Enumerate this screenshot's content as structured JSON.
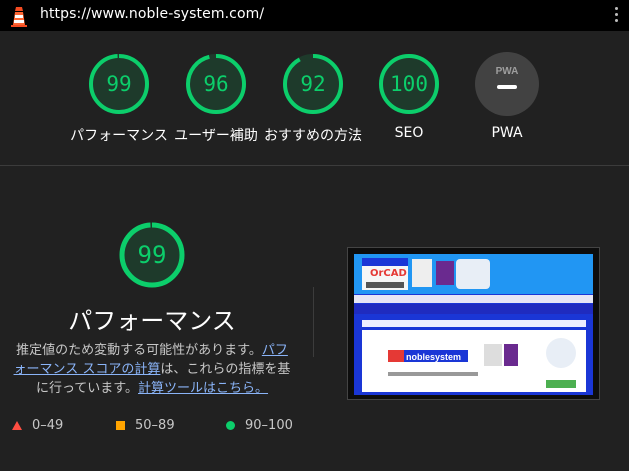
{
  "topbar": {
    "url": "https://www.noble-system.com/"
  },
  "colors": {
    "pass": "#0cce6b",
    "average": "#ffa400",
    "fail": "#ff4e42",
    "background": "#212121"
  },
  "gauges": [
    {
      "id": "performance",
      "score": "99",
      "label": "パフォーマンス",
      "fraction": 0.99
    },
    {
      "id": "accessibility",
      "score": "96",
      "label": "ユーザー補助",
      "fraction": 0.96
    },
    {
      "id": "best-practices",
      "score": "92",
      "label": "おすすめの方法",
      "fraction": 0.92
    },
    {
      "id": "seo",
      "score": "100",
      "label": "SEO",
      "fraction": 1.0
    },
    {
      "id": "pwa",
      "badge": "PWA",
      "label": "PWA"
    }
  ],
  "detail": {
    "score": "99",
    "fraction": 0.99,
    "title": "パフォーマンス",
    "desc_prefix": "推定値のため変動する可能性があります。",
    "link1": "パフォーマンス スコアの計算",
    "desc_middle": "は、これらの指標を基に行っています。",
    "link2": "計算ツールはこちら。"
  },
  "legend": [
    {
      "icon": "triangle-icon",
      "range": "0–49"
    },
    {
      "icon": "square-icon",
      "range": "50–89"
    },
    {
      "icon": "circle-icon",
      "range": "90–100"
    }
  ],
  "screenshot": {
    "logo_text": "OrCAD",
    "brand_text": "noblesystem"
  }
}
